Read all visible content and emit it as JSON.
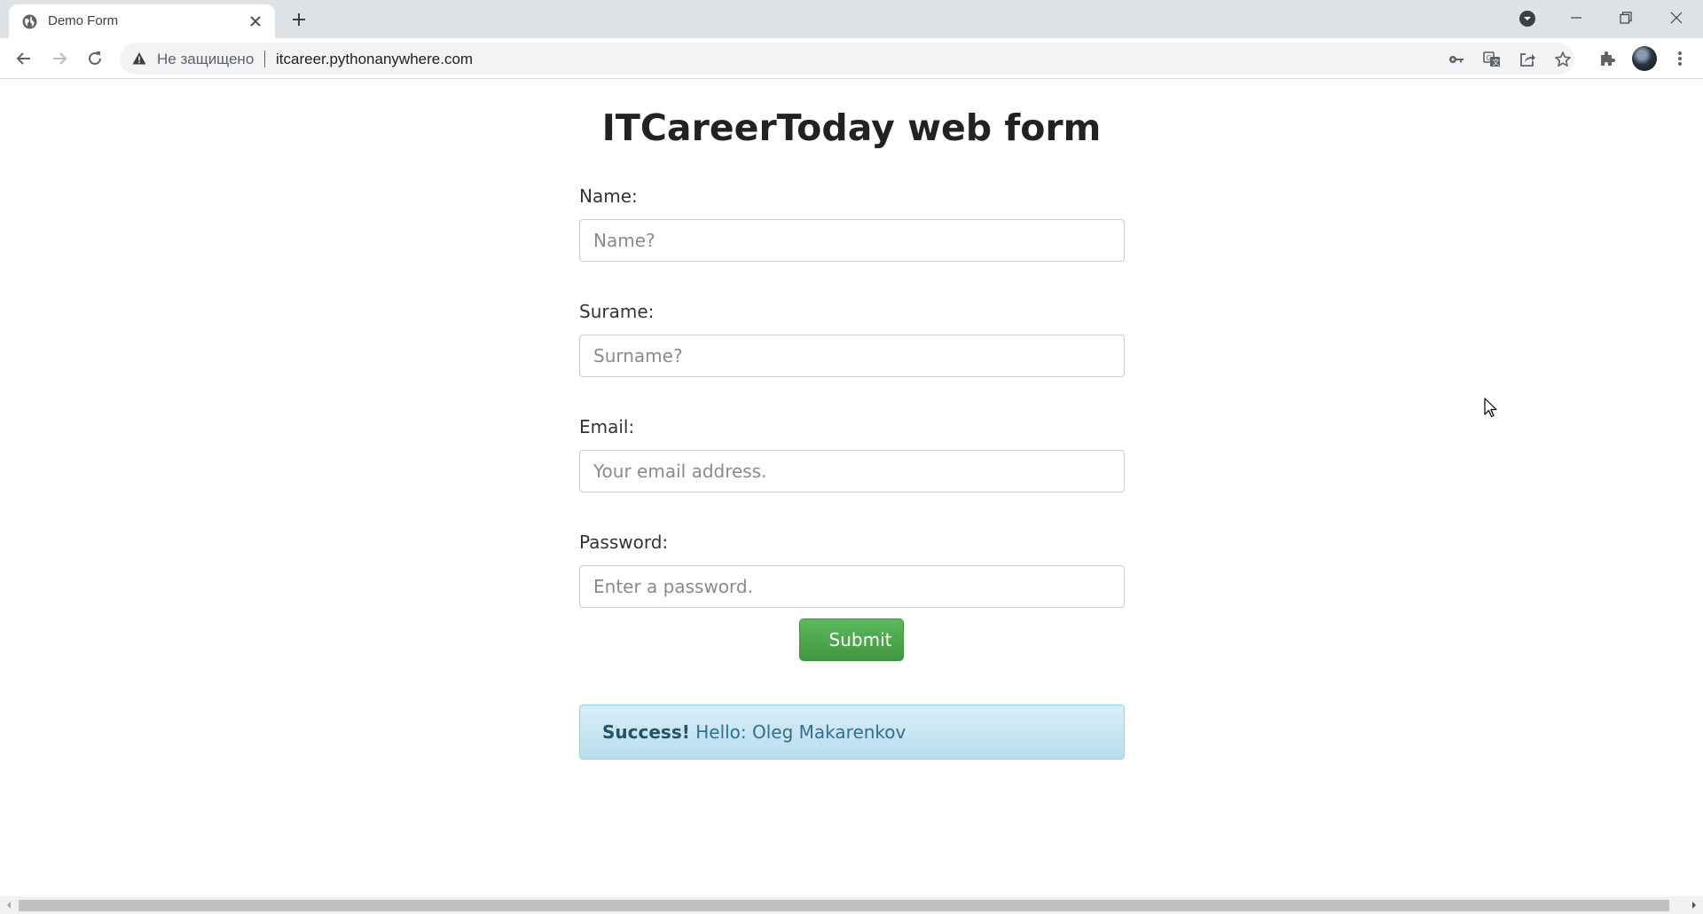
{
  "browser": {
    "tab_title": "Demo Form",
    "security_label": "Не защищено",
    "url": "itcareer.pythonanywhere.com",
    "icons": {
      "favicon": "globe-icon",
      "tab_close": "close-icon",
      "new_tab": "plus-icon",
      "tab_search": "chevron-down-icon",
      "back": "arrow-left-icon",
      "forward": "arrow-right-icon",
      "reload": "reload-icon",
      "security": "warning-icon",
      "passwords": "key-icon",
      "translate": "translate-icon",
      "share": "share-icon",
      "bookmark": "star-icon",
      "extensions": "puzzle-icon",
      "menu": "kebab-menu-icon"
    }
  },
  "page": {
    "title": "ITCareerToday web form",
    "fields": [
      {
        "label": "Name:",
        "placeholder": "Name?",
        "value": ""
      },
      {
        "label": "Surame:",
        "placeholder": "Surname?",
        "value": ""
      },
      {
        "label": "Email:",
        "placeholder": "Your email address.",
        "value": ""
      },
      {
        "label": "Password:",
        "placeholder": "Enter a password.",
        "value": ""
      }
    ],
    "submit_label": "Submit",
    "alert": {
      "strong": "Success!",
      "message": "Hello: Oleg Makarenkov"
    }
  },
  "colors": {
    "submit_green": "#4cae4c",
    "alert_bg": "#d9edf7",
    "alert_text": "#31708f"
  }
}
